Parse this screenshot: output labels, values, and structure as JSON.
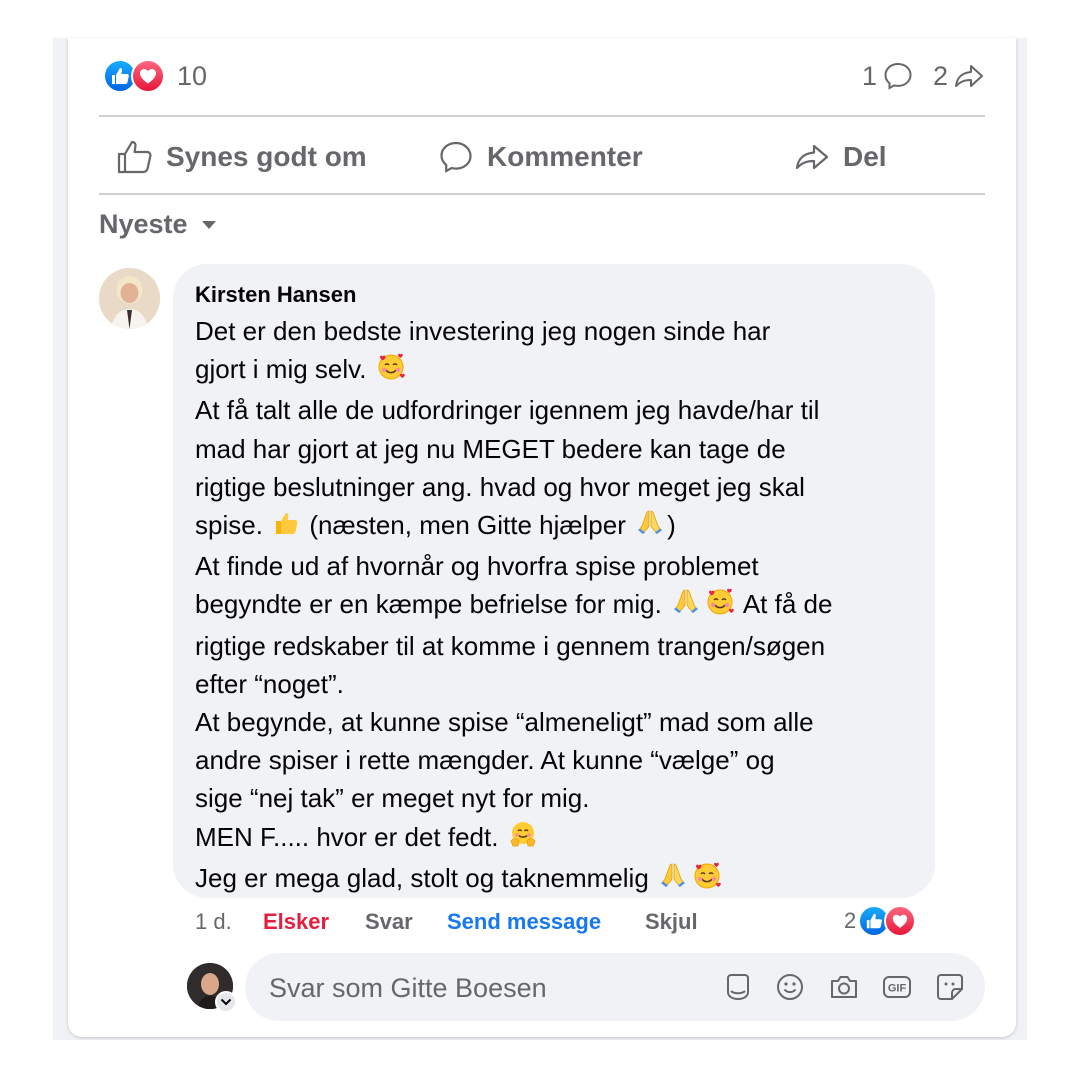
{
  "post": {
    "reaction_count": "10",
    "comment_count": "1",
    "share_count": "2",
    "reaction_icons": [
      "like-icon",
      "love-icon"
    ]
  },
  "actions": {
    "like": "Synes godt om",
    "comment": "Kommenter",
    "share": "Del"
  },
  "sort": {
    "label": "Nyeste"
  },
  "comment": {
    "author": "Kirsten Hansen",
    "lines": [
      {
        "text": "Det er den bedste investering jeg nogen sinde har",
        "emojis": []
      },
      {
        "text": "gjort i mig selv.",
        "emojis": [
          "smiling-face-with-hearts"
        ]
      },
      {
        "text": "At få talt alle de udfordringer igennem jeg havde/har til",
        "emojis": []
      },
      {
        "text": "mad har gjort at jeg nu MEGET bedere kan tage de",
        "emojis": []
      },
      {
        "text": "rigtige beslutninger ang. hvad og hvor meget jeg skal",
        "emojis": []
      },
      {
        "text": "spise.",
        "emojis": [
          "thumbs-up"
        ],
        "after": "(næsten, men Gitte hjælper",
        "after_emojis": [
          "folded-hands"
        ],
        "tail": ")"
      },
      {
        "text": "At finde ud af hvornår og hvorfra spise problemet",
        "emojis": []
      },
      {
        "text": "begyndte er en kæmpe befrielse for mig.",
        "emojis": [
          "folded-hands",
          "smiling-face-with-hearts"
        ],
        "after": "At få de"
      },
      {
        "text": "rigtige redskaber til at komme i gennem trangen/søgen",
        "emojis": []
      },
      {
        "text": "efter “noget”.",
        "emojis": []
      },
      {
        "text": "At begynde, at kunne spise “almeneligt” mad som alle",
        "emojis": []
      },
      {
        "text": "andre spiser i rette mængder. At kunne “vælge” og",
        "emojis": []
      },
      {
        "text": "sige “nej tak” er meget nyt for mig.",
        "emojis": []
      },
      {
        "text": "MEN F..... hvor er det fedt.",
        "emojis": [
          "hugging-face"
        ]
      },
      {
        "text": "Jeg er mega glad, stolt og taknemmelig",
        "emojis": [
          "folded-hands",
          "smiling-face-with-hearts"
        ]
      }
    ],
    "time": "1 d.",
    "reaction_label": "Elsker",
    "reply_label": "Svar",
    "message_label": "Send message",
    "hide_label": "Skjul",
    "reaction_count": "2"
  },
  "reply_box": {
    "placeholder": "Svar som Gitte Boesen",
    "tools": [
      "sticker-icon",
      "emoji-icon",
      "camera-icon",
      "gif-icon",
      "avatar-sticker-icon"
    ]
  },
  "colors": {
    "love_red": "#e41e3f",
    "link_blue": "#1877f2",
    "muted_gray": "#65676b",
    "bubble_gray": "#f0f2f5"
  }
}
